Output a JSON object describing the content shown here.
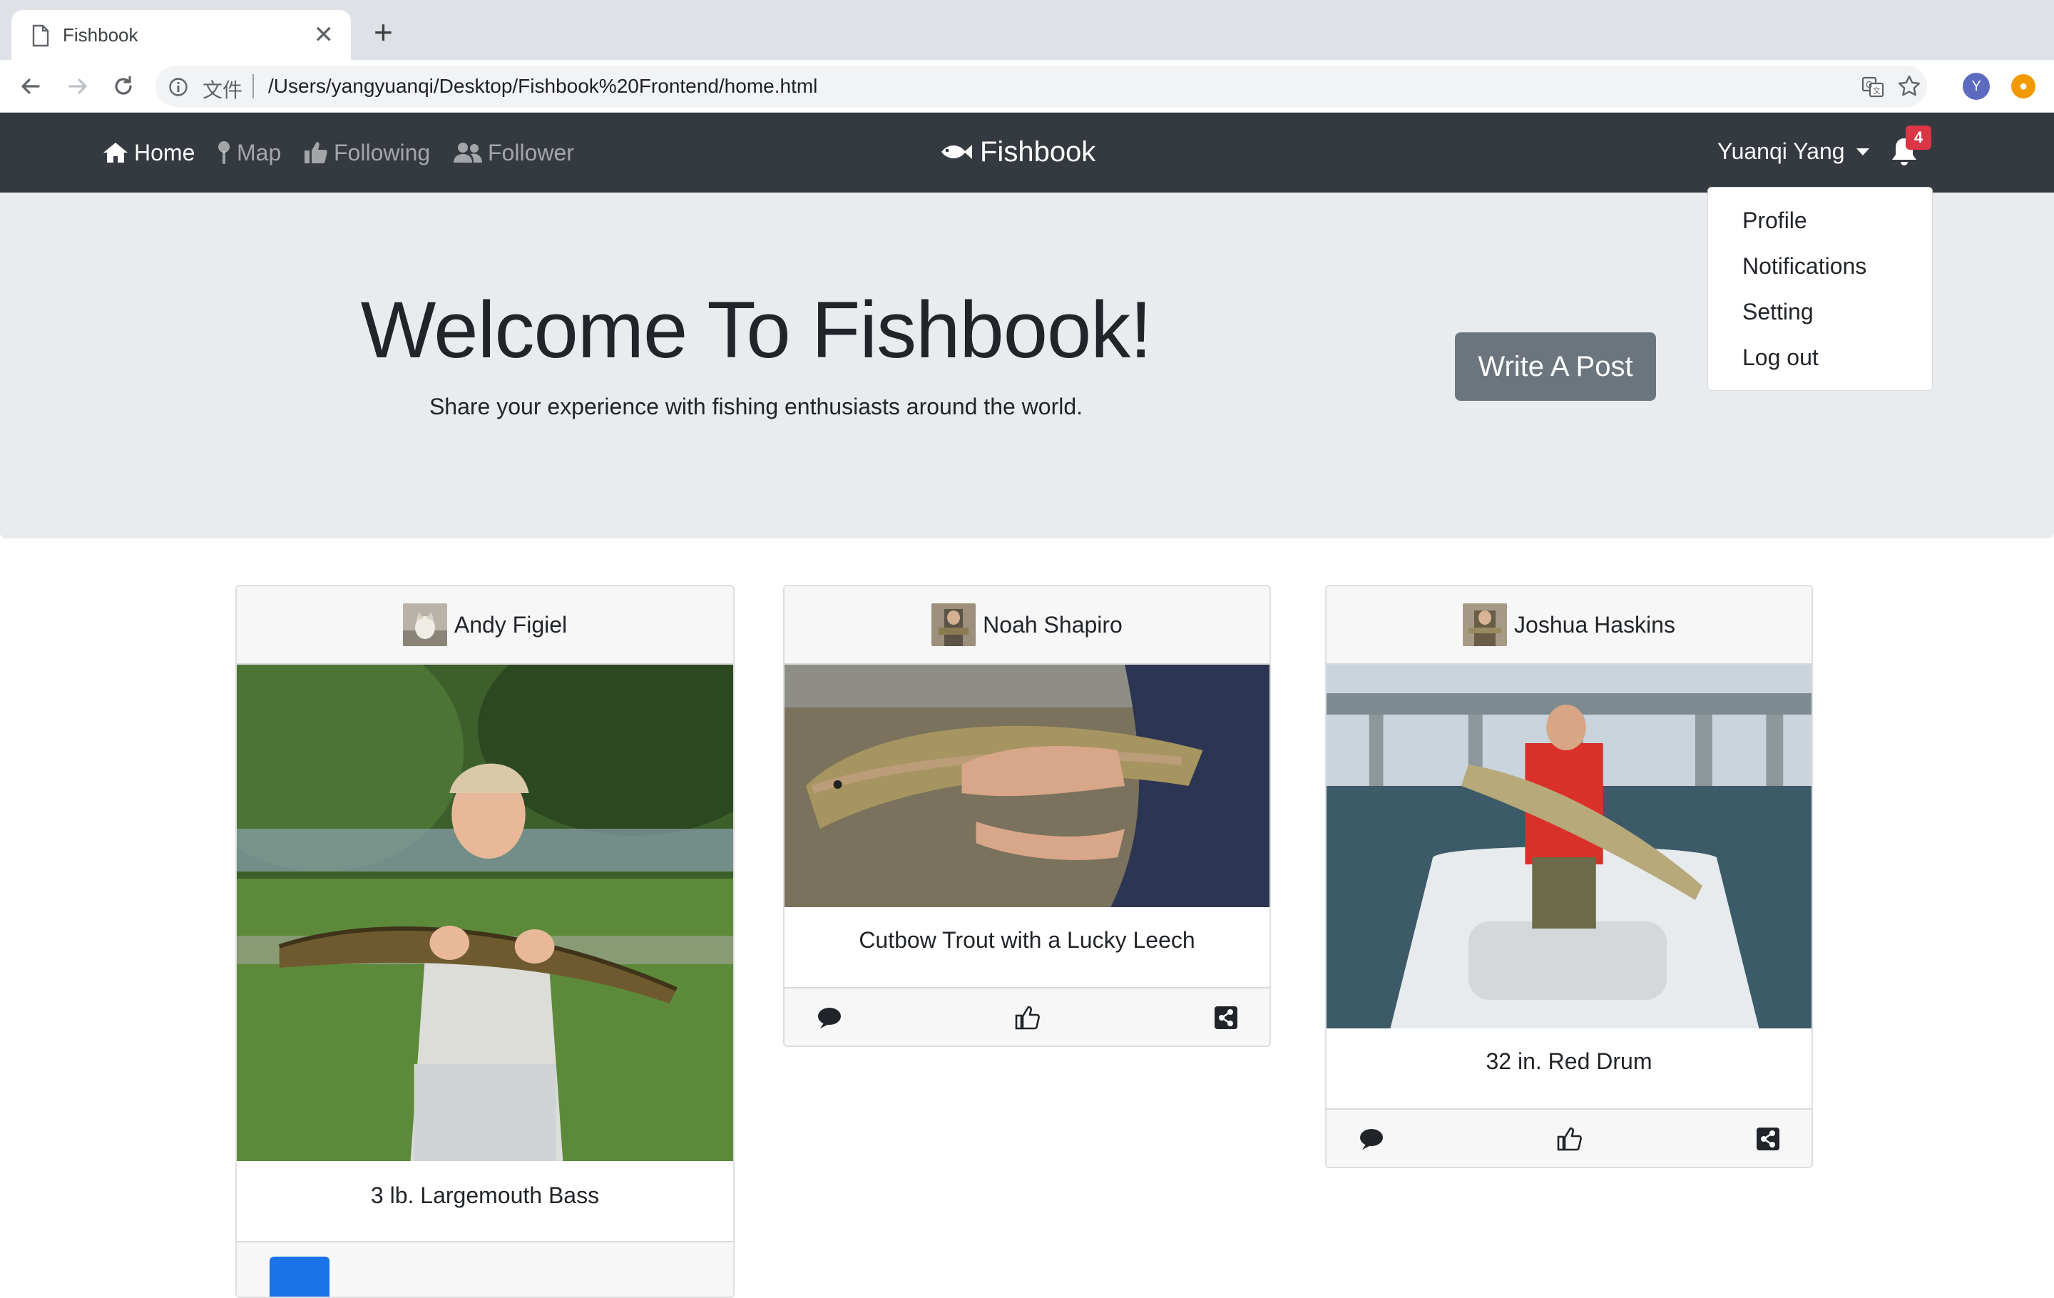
{
  "browser": {
    "tab_title": "Fishbook",
    "new_tab_symbol": "+",
    "close_symbol": "✕",
    "file_label": "文件",
    "url": "/Users/yangyuanqi/Desktop/Fishbook%20Frontend/home.html",
    "profile_initial": "Y"
  },
  "navbar": {
    "links": [
      {
        "label": "Home",
        "icon": "home-icon",
        "active": true
      },
      {
        "label": "Map",
        "icon": "map-marker-icon",
        "active": false
      },
      {
        "label": "Following",
        "icon": "thumbs-up-icon",
        "active": false
      },
      {
        "label": "Follower",
        "icon": "users-icon",
        "active": false
      }
    ],
    "brand": "Fishbook",
    "brand_icon": "fish-icon",
    "user_name": "Yuanqi Yang",
    "notification_count": "4"
  },
  "user_menu": {
    "items": [
      "Profile",
      "Notifications",
      "Setting",
      "Log out"
    ]
  },
  "jumbotron": {
    "title": "Welcome To Fishbook!",
    "subtitle": "Share your experience with fishing enthusiasts around the world.",
    "button": "Write A Post"
  },
  "posts": [
    {
      "author": "Andy Figiel",
      "caption": "3 lb. Largemouth Bass"
    },
    {
      "author": "Noah Shapiro",
      "caption": "Cutbow Trout with a Lucky Leech"
    },
    {
      "author": "Joshua Haskins",
      "caption": "32 in. Red Drum"
    }
  ],
  "colors": {
    "navbar_bg": "#343a40",
    "jumbotron_bg": "#e9ecef",
    "button_secondary": "#6c757d",
    "badge_danger": "#dc3545"
  }
}
